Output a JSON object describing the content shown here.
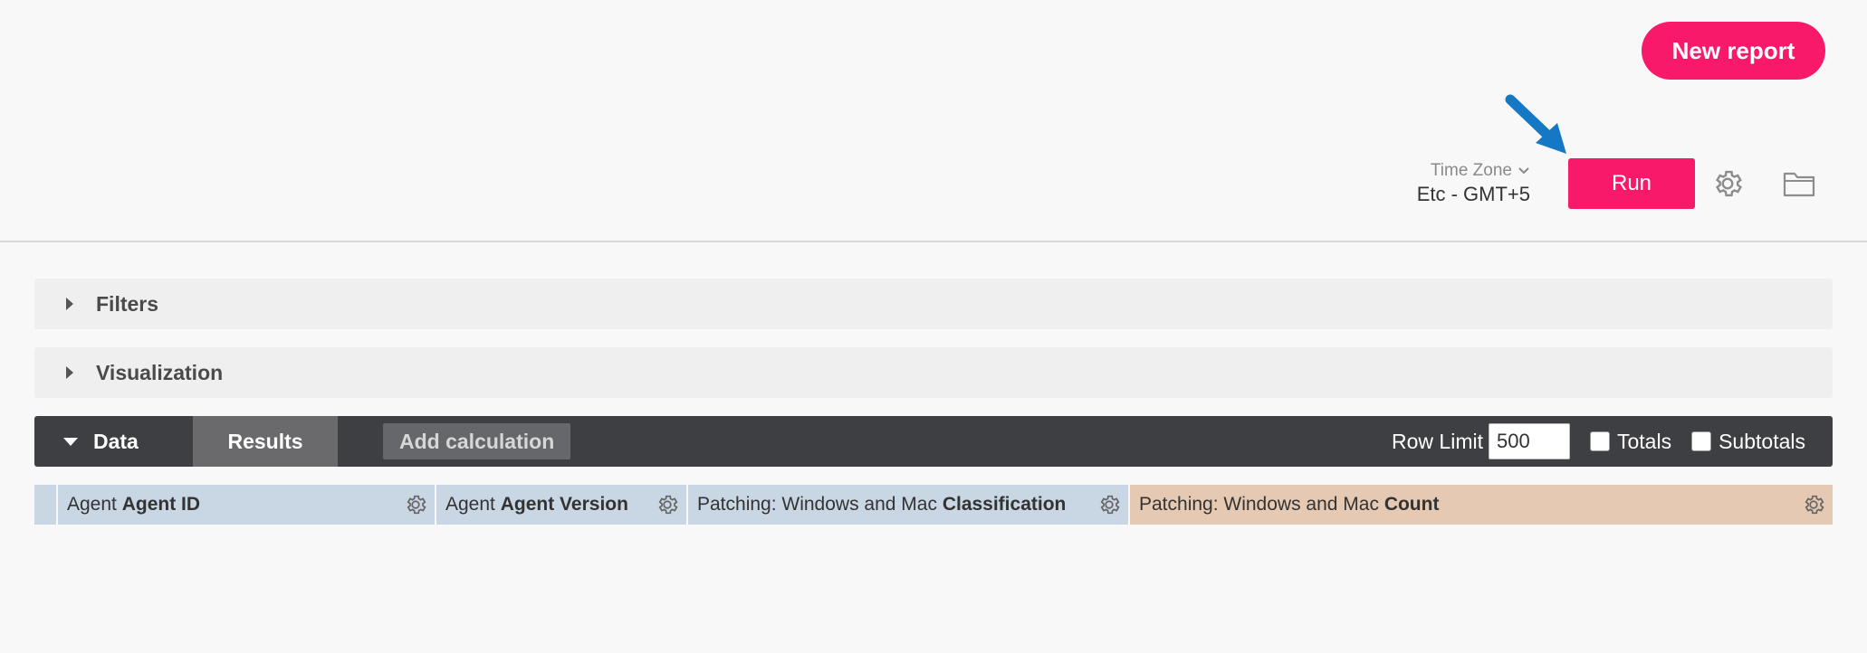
{
  "header": {
    "new_report_label": "New report",
    "time_zone_label": "Time Zone",
    "time_zone_value": "Etc - GMT+5",
    "run_label": "Run"
  },
  "sections": {
    "filters_label": "Filters",
    "visualization_label": "Visualization"
  },
  "databar": {
    "data_tab": "Data",
    "results_tab": "Results",
    "add_calculation": "Add calculation",
    "row_limit_label": "Row Limit",
    "row_limit_value": "500",
    "totals_label": "Totals",
    "subtotals_label": "Subtotals"
  },
  "columns": [
    {
      "prefix": "Agent",
      "name": "Agent ID",
      "kind": "dimension"
    },
    {
      "prefix": "Agent",
      "name": "Agent Version",
      "kind": "dimension"
    },
    {
      "prefix": "Patching: Windows and Mac",
      "name": "Classification",
      "kind": "dimension"
    },
    {
      "prefix": "Patching: Windows and Mac",
      "name": "Count",
      "kind": "measure"
    }
  ],
  "colors": {
    "accent": "#f8196b",
    "databar_bg": "#3e3f42",
    "dimension_col": "#c9d6e3",
    "measure_col": "#e5c9b3",
    "annotation_arrow": "#1478c4"
  },
  "icons": [
    "chevron-down-icon",
    "gear-icon",
    "folder-icon",
    "caret-right-icon",
    "caret-down-icon",
    "annotation-arrow"
  ]
}
